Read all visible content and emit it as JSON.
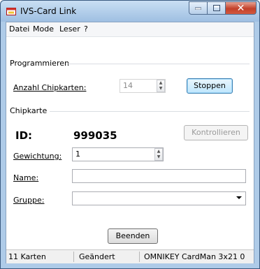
{
  "window": {
    "title": "IVS-Card Link"
  },
  "menu": [
    "Datei",
    "Mode",
    "Leser",
    "?"
  ],
  "programmieren": {
    "section_label": "Programmieren",
    "anzahl_label": "Anzahl Chipkarten:",
    "anzahl_value": "14",
    "stoppen_label": "Stoppen"
  },
  "chipkarte": {
    "section_label": "Chipkarte",
    "id_label": "ID:",
    "id_value": "999035",
    "kontrollieren_label": "Kontrollieren",
    "gewichtung_label": "Gewichtung:",
    "gewichtung_value": "1",
    "name_label": "Name:",
    "name_value": "",
    "gruppe_label": "Gruppe:",
    "gruppe_value": ""
  },
  "beenden_label": "Beenden",
  "status": {
    "count": "11 Karten",
    "state": "Geändert",
    "reader": "OMNIKEY CardMan 3x21 0"
  }
}
